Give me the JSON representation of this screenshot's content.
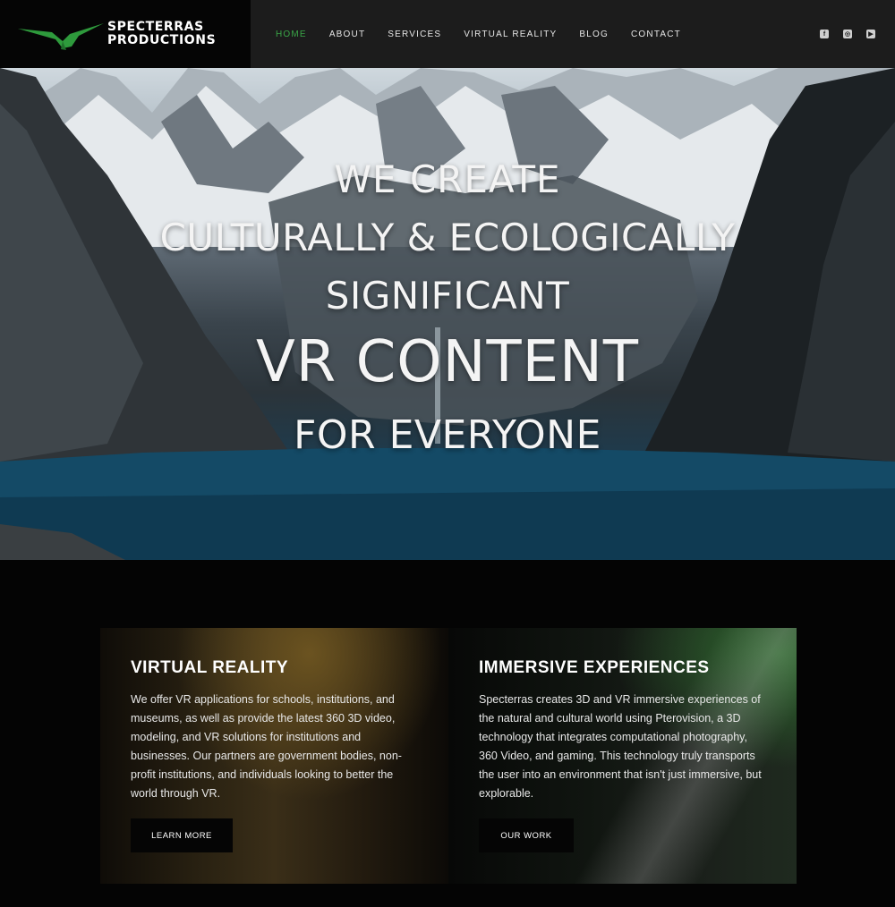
{
  "brand": {
    "name_line1": "SPECTERRAS",
    "name_line2": "PRODUCTIONS",
    "logo_icon": "pterodactyl-icon",
    "accent_color": "#3aa547"
  },
  "nav": {
    "items": [
      {
        "label": "HOME",
        "active": true
      },
      {
        "label": "ABOUT",
        "active": false
      },
      {
        "label": "SERVICES",
        "active": false
      },
      {
        "label": "VIRTUAL REALITY",
        "active": false
      },
      {
        "label": "BLOG",
        "active": false
      },
      {
        "label": "CONTACT",
        "active": false
      }
    ]
  },
  "socials": [
    {
      "icon": "facebook-icon",
      "glyph": "f"
    },
    {
      "icon": "instagram-icon",
      "glyph": "◎"
    },
    {
      "icon": "youtube-icon",
      "glyph": "▶"
    }
  ],
  "hero": {
    "line1": "WE CREATE",
    "line2": "CULTURALLY & ECOLOGICALLY",
    "line3": "SIGNIFICANT",
    "line4": "VR CONTENT",
    "line5": "FOR EVERYONE"
  },
  "cards": [
    {
      "title": "VIRTUAL REALITY",
      "body": "We offer VR applications for schools, institutions, and museums, as well as provide the latest 360 3D video, modeling, and VR solutions for institutions and businesses. Our partners are government bodies, non-profit institutions, and individuals looking to better the world through VR.",
      "button": "LEARN MORE"
    },
    {
      "title": "IMMERSIVE EXPERIENCES",
      "body": "Specterras creates 3D and VR immersive experiences of the natural and cultural world using Pterovision, a 3D technology that integrates computational photography, 360 Video, and gaming. This technology truly transports the user into an environment that isn't just immersive, but explorable.",
      "button": "OUR WORK"
    }
  ]
}
